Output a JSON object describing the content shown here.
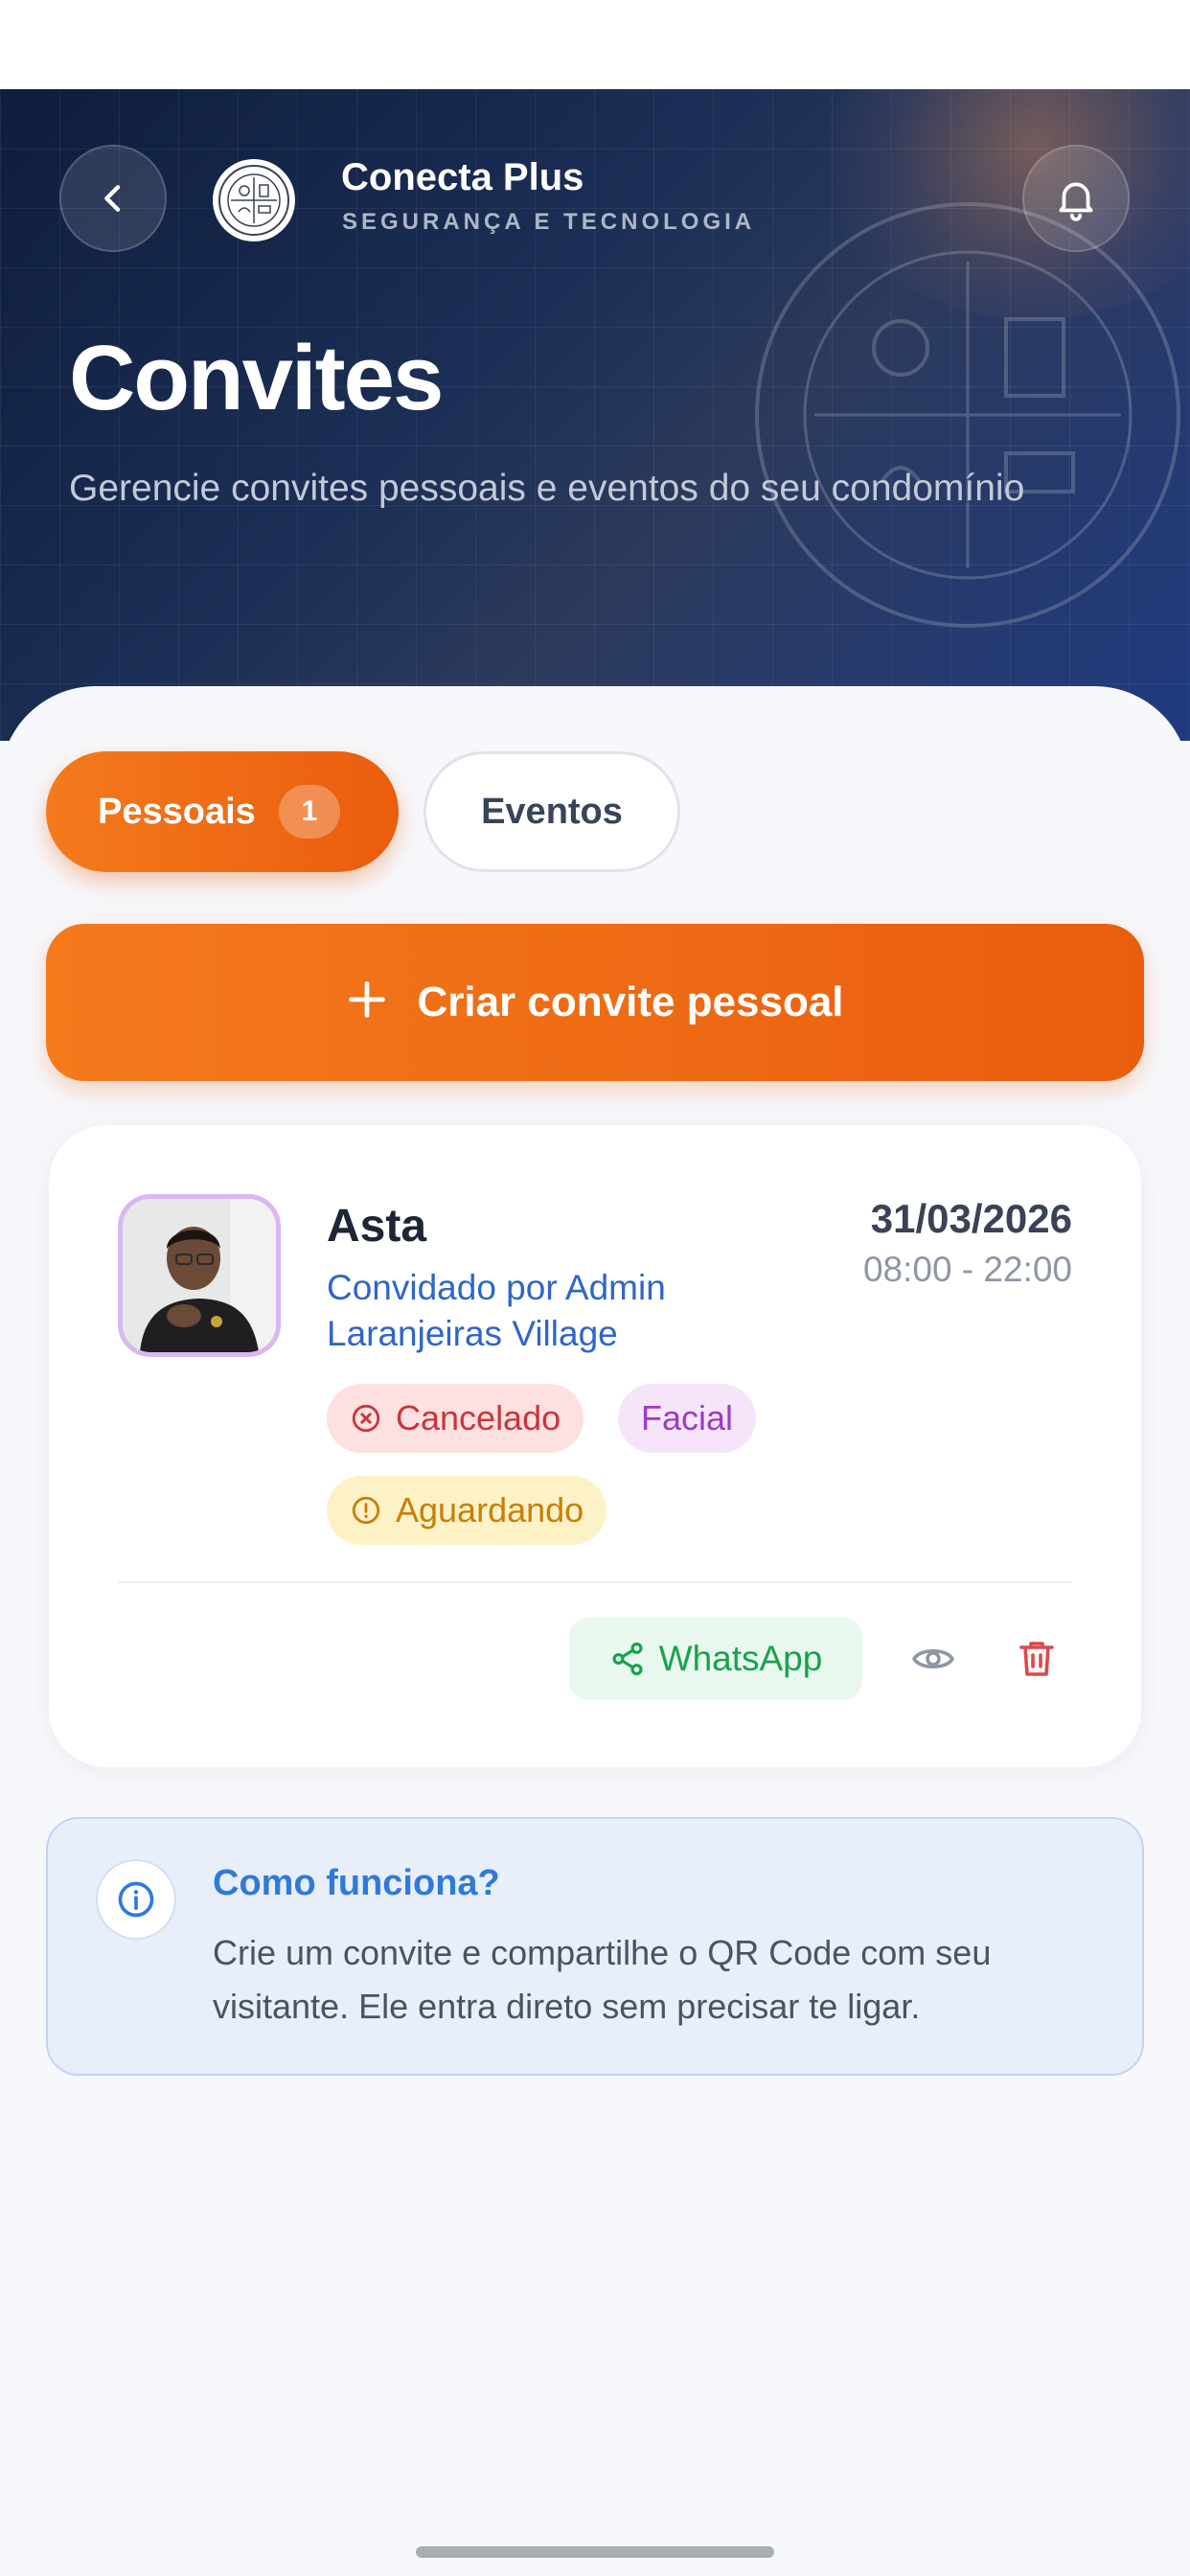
{
  "header": {
    "app_name": "Conecta Plus",
    "app_tagline": "SEGURANÇA E TECNOLOGIA",
    "title": "Convites",
    "subtitle": "Gerencie convites pessoais e eventos do seu condomínio"
  },
  "tabs": [
    {
      "label": "Pessoais",
      "count": "1",
      "active": true
    },
    {
      "label": "Eventos",
      "active": false
    }
  ],
  "create_button": {
    "label": "Criar convite pessoal"
  },
  "invite": {
    "name": "Asta",
    "invited_by": "Convidado por Admin Laranjeiras Village",
    "date": "31/03/2026",
    "time": "08:00 - 22:00",
    "status": "Cancelado",
    "access_type": "Facial",
    "approval": "Aguardando",
    "share_label": "WhatsApp"
  },
  "info": {
    "title": "Como funciona?",
    "text": "Crie um convite e compartilhe o QR Code com seu visitante. Ele entra direto sem precisar te ligar."
  },
  "colors": {
    "accent": "#ea5d0e",
    "hero_dark": "#0f1d3d",
    "link_blue": "#2f66c8",
    "cancel_red": "#c9353b",
    "facial_purple": "#9c3bc1",
    "waiting_amber": "#c77f08",
    "whatsapp_green": "#16a34a"
  },
  "icons": [
    "back-icon",
    "logo-seal",
    "bell-icon",
    "plus-icon",
    "x-circle-icon",
    "alert-circle-icon",
    "share-icon",
    "eye-icon",
    "trash-icon",
    "info-icon"
  ]
}
